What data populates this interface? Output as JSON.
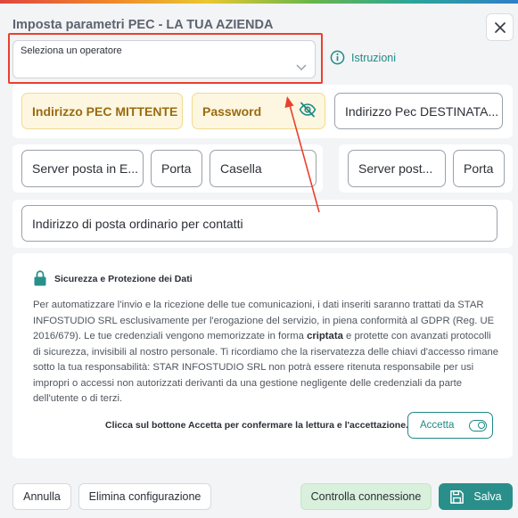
{
  "dialog": {
    "title": "Imposta parametri PEC - LA TUA AZIENDA",
    "close_icon": "close-icon"
  },
  "operator": {
    "placeholder": "Seleziona un operatore",
    "icon": "chevron-down-icon"
  },
  "help": {
    "label": "Istruzioni",
    "icon": "info-icon"
  },
  "fields": {
    "sender_pec": "Indirizzo PEC MITTENTE",
    "password": "Password",
    "password_icon": "eye-off-icon",
    "recipient_pec": "Indirizzo Pec DESTINATA...",
    "out_server": "Server posta in E...",
    "out_port": "Porta",
    "mailbox": "Casella",
    "in_server": "Server post...",
    "in_port": "Porta",
    "contact_email": "Indirizzo di posta ordinario per contatti"
  },
  "security": {
    "icon": "lock-icon",
    "title": "Sicurezza e Protezione dei Dati",
    "body_part1": "Per automatizzare l'invio e la ricezione delle tue comunicazioni, i dati inseriti saranno trattati da STAR INFOSTUDIO SRL esclusivamente per l'erogazione del servizio, in piena conformità al GDPR (Reg. UE 2016/679). Le tue credenziali vengono memorizzate in forma ",
    "body_bold": "criptata",
    "body_part2": " e protette con avanzati protocolli di sicurezza, invisibili al nostro personale. Ti ricordiamo che la riservatezza delle chiavi d'accesso rimane sotto la tua responsabilità: STAR INFOSTUDIO SRL non potrà essere ritenuta responsabile per usi impropri o accessi non autorizzati derivanti da una gestione negligente delle credenziali da parte dell'utente o di terzi.",
    "accept_prompt": "Clicca sul bottone Accetta per confermare la lettura e l'accettazione.",
    "accept_label": "Accetta",
    "accept_icon": "toggle-icon"
  },
  "footer": {
    "cancel": "Annulla",
    "delete": "Elimina configurazione",
    "check": "Controlla connessione",
    "save": "Salva",
    "save_icon": "floppy-disk-icon"
  },
  "colors": {
    "accent": "#2a8f8a",
    "highlight": "#e8412f",
    "warning_bg": "#fdf7e1"
  }
}
